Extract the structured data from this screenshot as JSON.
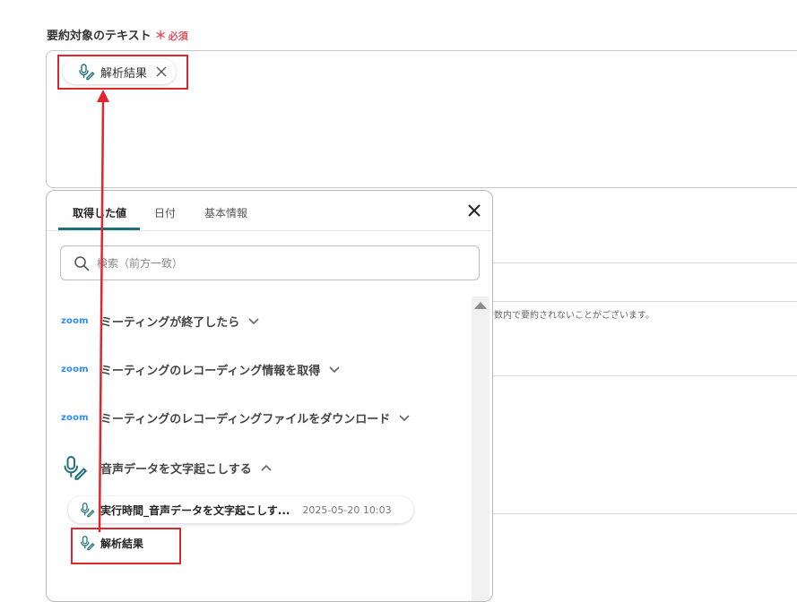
{
  "field": {
    "label": "要約対象のテキスト",
    "required_star": "＊",
    "required_text": "必須"
  },
  "selected_chip": {
    "text": "解析結果"
  },
  "background_note": "数内で要約されないことがございます。",
  "popup": {
    "tabs": [
      {
        "label": "取得した値"
      },
      {
        "label": "日付"
      },
      {
        "label": "基本情報"
      }
    ],
    "search": {
      "placeholder": "検索（前方一致）"
    },
    "steps": [
      {
        "logo": "zoom",
        "label": "ミーティングが終了したら"
      },
      {
        "logo": "zoom",
        "label": "ミーティングのレコーディング情報を取得"
      },
      {
        "logo": "zoom",
        "label": "ミーティングのレコーディングファイルをダウンロード"
      },
      {
        "logo": "mic-pen-icon",
        "label": "音声データを文字起こしする"
      }
    ],
    "result": {
      "title": "実行時間_音声データを文字起こしす...",
      "timestamp": "2025-05-20 10:03",
      "item": "解析結果"
    }
  },
  "colors": {
    "accent": "#1d6f7a",
    "annotation_red": "#e0262e",
    "required": "#e05561",
    "zoom_blue": "#2d8cff"
  }
}
